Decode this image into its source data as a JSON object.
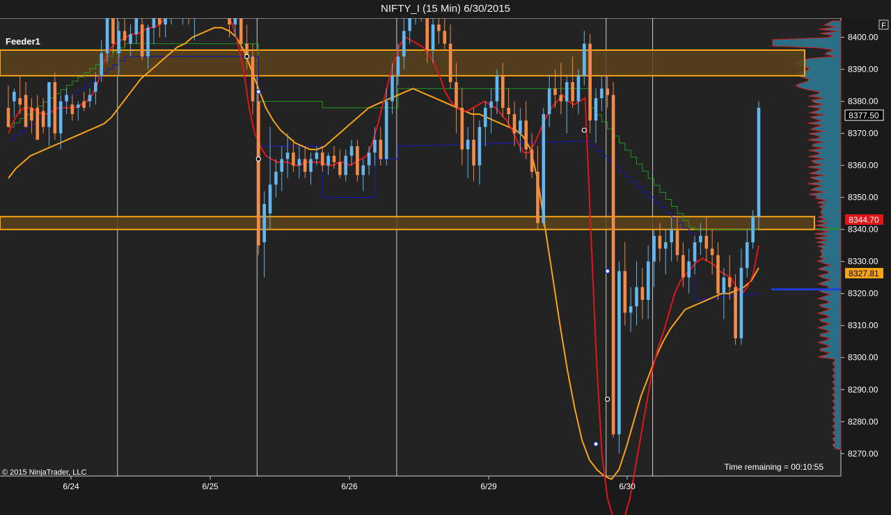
{
  "window": {
    "title": "NIFTY_I (15 Min)  6/30/2015",
    "f_button": "F"
  },
  "panel": {
    "feeder_label": "Feeder1",
    "copyright": "© 2015 NinjaTrader, LLC",
    "time_remaining": "Time remaining = 00:10:55"
  },
  "price_markers": {
    "last": "8377.50",
    "red": "8344.70",
    "orange": "8327.81"
  },
  "colors": {
    "background": "#232323",
    "up_candle": "#63b6ee",
    "down_candle": "#f18b4a",
    "red_ma": "#e0161b",
    "orange_ma": "#f7a416",
    "blue_line": "#1a1aa0",
    "green_line": "#1f9a1f",
    "zone_fill": "#5a431c",
    "zone_border": "#f7a416",
    "profile_fill": "#2a6f85",
    "profile_edge": "#d81e1e"
  },
  "chart_data": {
    "type": "candlestick",
    "title": "NIFTY_I (15 Min)  6/30/2015",
    "ylim": [
      8263,
      8406
    ],
    "y_ticks": [
      "8400.00",
      "8390.00",
      "8380.00",
      "8370.00",
      "8360.00",
      "8350.00",
      "8340.00",
      "8330.00",
      "8320.00",
      "8310.00",
      "8300.00",
      "8290.00",
      "8280.00",
      "8270.00"
    ],
    "x_ticks": [
      "6/24",
      "6/25",
      "6/26",
      "6/29",
      "6/30"
    ],
    "zones": [
      {
        "top": 8396,
        "bottom": 8388
      },
      {
        "top": 8344,
        "bottom": 8340
      }
    ],
    "candles": [
      [
        8378,
        8385,
        8372,
        8372
      ],
      [
        8380,
        8384,
        8375,
        8383
      ],
      [
        8381,
        8388,
        8376,
        8379
      ],
      [
        8382,
        8386,
        8372,
        8372
      ],
      [
        8378,
        8381,
        8370,
        8374
      ],
      [
        8378,
        8382,
        8368,
        8368
      ],
      [
        8377,
        8381,
        8370,
        8372
      ],
      [
        8372,
        8386,
        8366,
        8386
      ],
      [
        8386,
        8389,
        8368,
        8370
      ],
      [
        8370,
        8382,
        8365,
        8380
      ],
      [
        8380,
        8384,
        8376,
        8382
      ],
      [
        8379,
        8382,
        8374,
        8376
      ],
      [
        8378,
        8380,
        8374,
        8379
      ],
      [
        8380,
        8383,
        8377,
        8378
      ],
      [
        8380,
        8384,
        8378,
        8382
      ],
      [
        8383,
        8389,
        8379,
        8386
      ],
      [
        8388,
        8399,
        8386,
        8395
      ],
      [
        8395,
        8412,
        8392,
        8412
      ],
      [
        8410,
        8414,
        8395,
        8398
      ],
      [
        8395,
        8405,
        8388,
        8402
      ],
      [
        8402,
        8406,
        8397,
        8399
      ],
      [
        8398,
        8404,
        8394,
        8401
      ],
      [
        8401,
        8411,
        8398,
        8409
      ],
      [
        8404,
        8407,
        8393,
        8394
      ],
      [
        8394,
        8404,
        8390,
        8403
      ],
      [
        8403,
        8410,
        8398,
        8406
      ],
      [
        8406,
        8411,
        8400,
        8404
      ],
      [
        8404,
        8412,
        8400,
        8410
      ],
      [
        8410,
        8416,
        8404,
        8414
      ],
      [
        8414,
        8418,
        8408,
        8410
      ],
      [
        8410,
        8416,
        8404,
        8412
      ],
      [
        8412,
        8416,
        8404,
        8406
      ],
      [
        8406,
        8414,
        8399,
        8410
      ],
      [
        8410,
        8418,
        8406,
        8414
      ],
      [
        8414,
        8420,
        8410,
        8416
      ],
      [
        8416,
        8420,
        8412,
        8418
      ],
      [
        8418,
        8422,
        8412,
        8414
      ],
      [
        8414,
        8418,
        8408,
        8410
      ],
      [
        8410,
        8414,
        8400,
        8404
      ],
      [
        8404,
        8412,
        8400,
        8408
      ],
      [
        8408,
        8412,
        8396,
        8398
      ],
      [
        8398,
        8404,
        8390,
        8394
      ],
      [
        8394,
        8398,
        8376,
        8380
      ],
      [
        8380,
        8384,
        8332,
        8335
      ],
      [
        8336,
        8352,
        8325,
        8348
      ],
      [
        8345,
        8372,
        8340,
        8354
      ],
      [
        8354,
        8362,
        8350,
        8358
      ],
      [
        8358,
        8366,
        8352,
        8362
      ],
      [
        8362,
        8370,
        8356,
        8364
      ],
      [
        8364,
        8368,
        8358,
        8360
      ],
      [
        8360,
        8366,
        8356,
        8362
      ],
      [
        8362,
        8366,
        8356,
        8358
      ],
      [
        8358,
        8364,
        8354,
        8362
      ],
      [
        8362,
        8366,
        8360,
        8364
      ],
      [
        8364,
        8366,
        8358,
        8360
      ],
      [
        8360,
        8364,
        8357,
        8363
      ],
      [
        8363,
        8366,
        8359,
        8361
      ],
      [
        8361,
        8365,
        8356,
        8357
      ],
      [
        8357,
        8365,
        8355,
        8363
      ],
      [
        8363,
        8368,
        8360,
        8366
      ],
      [
        8366,
        8368,
        8355,
        8357
      ],
      [
        8357,
        8362,
        8352,
        8360
      ],
      [
        8360,
        8366,
        8357,
        8364
      ],
      [
        8364,
        8372,
        8360,
        8368
      ],
      [
        8368,
        8372,
        8360,
        8362
      ],
      [
        8362,
        8384,
        8360,
        8380
      ],
      [
        8380,
        8392,
        8376,
        8388
      ],
      [
        8388,
        8398,
        8385,
        8394
      ],
      [
        8394,
        8406,
        8390,
        8402
      ],
      [
        8402,
        8412,
        8398,
        8408
      ],
      [
        8408,
        8418,
        8404,
        8414
      ],
      [
        8414,
        8420,
        8405,
        8408
      ],
      [
        8408,
        8412,
        8392,
        8396
      ],
      [
        8396,
        8408,
        8392,
        8404
      ],
      [
        8404,
        8412,
        8398,
        8402
      ],
      [
        8402,
        8408,
        8396,
        8398
      ],
      [
        8398,
        8404,
        8384,
        8386
      ],
      [
        8386,
        8392,
        8370,
        8378
      ],
      [
        8378,
        8384,
        8360,
        8365
      ],
      [
        8365,
        8372,
        8356,
        8368
      ],
      [
        8368,
        8378,
        8355,
        8360
      ],
      [
        8360,
        8374,
        8354,
        8372
      ],
      [
        8372,
        8380,
        8366,
        8378
      ],
      [
        8378,
        8384,
        8370,
        8380
      ],
      [
        8380,
        8390,
        8376,
        8388
      ],
      [
        8388,
        8392,
        8375,
        8378
      ],
      [
        8378,
        8384,
        8372,
        8376
      ],
      [
        8376,
        8380,
        8366,
        8370
      ],
      [
        8370,
        8378,
        8364,
        8374
      ],
      [
        8374,
        8380,
        8362,
        8365
      ],
      [
        8365,
        8370,
        8356,
        8358
      ],
      [
        8358,
        8366,
        8340,
        8342
      ],
      [
        8342,
        8378,
        8341,
        8376
      ],
      [
        8376,
        8388,
        8372,
        8384
      ],
      [
        8384,
        8390,
        8378,
        8382
      ],
      [
        8382,
        8392,
        8376,
        8380
      ],
      [
        8380,
        8388,
        8370,
        8386
      ],
      [
        8386,
        8394,
        8378,
        8380
      ],
      [
        8380,
        8390,
        8376,
        8388
      ],
      [
        8388,
        8402,
        8385,
        8398
      ],
      [
        8398,
        8401,
        8370,
        8374
      ],
      [
        8374,
        8384,
        8367,
        8381
      ],
      [
        8381,
        8388,
        8377,
        8384
      ],
      [
        8384,
        8388,
        8378,
        8382
      ],
      [
        8382,
        8386,
        8275,
        8276
      ],
      [
        8276,
        8330,
        8270,
        8327
      ],
      [
        8327,
        8336,
        8310,
        8314
      ],
      [
        8314,
        8322,
        8308,
        8316
      ],
      [
        8316,
        8330,
        8310,
        8322
      ],
      [
        8322,
        8328,
        8312,
        8318
      ],
      [
        8318,
        8335,
        8312,
        8330
      ],
      [
        8330,
        8340,
        8322,
        8338
      ],
      [
        8338,
        8342,
        8330,
        8334
      ],
      [
        8334,
        8340,
        8326,
        8336
      ],
      [
        8336,
        8344,
        8330,
        8340
      ],
      [
        8340,
        8344,
        8330,
        8332
      ],
      [
        8332,
        8336,
        8322,
        8325
      ],
      [
        8325,
        8334,
        8320,
        8330
      ],
      [
        8330,
        8338,
        8326,
        8336
      ],
      [
        8336,
        8342,
        8332,
        8338
      ],
      [
        8338,
        8344,
        8330,
        8334
      ],
      [
        8334,
        8340,
        8326,
        8332
      ],
      [
        8332,
        8336,
        8318,
        8320
      ],
      [
        8320,
        8328,
        8312,
        8325
      ],
      [
        8325,
        8332,
        8318,
        8322
      ],
      [
        8322,
        8326,
        8304,
        8306
      ],
      [
        8306,
        8334,
        8304,
        8328
      ],
      [
        8328,
        8340,
        8325,
        8336
      ],
      [
        8336,
        8346,
        8334,
        8344
      ],
      [
        8344,
        8380,
        8340,
        8378
      ]
    ],
    "red_ma": [
      8370,
      8374,
      8377,
      8378,
      8378,
      8377,
      8376,
      8376,
      8377,
      8378,
      8378,
      8378,
      8378,
      8379,
      8380,
      8382,
      8386,
      8392,
      8396,
      8398,
      8399,
      8400,
      8401,
      8401,
      8402,
      8403,
      8403,
      8404,
      8406,
      8407,
      8408,
      8408,
      8409,
      8410,
      8411,
      8412,
      8413,
      8412,
      8410,
      8408,
      8404,
      8398,
      8390,
      8378,
      8370,
      8366,
      8363,
      8362,
      8361,
      8361,
      8361,
      8360,
      8360,
      8361,
      8361,
      8361,
      8361,
      8360,
      8360,
      8361,
      8361,
      8360,
      8361,
      8362,
      8363,
      8367,
      8373,
      8380,
      8387,
      8393,
      8398,
      8400,
      8399,
      8398,
      8397,
      8395,
      8392,
      8388,
      8383,
      8380,
      8378,
      8377,
      8377,
      8378,
      8379,
      8380,
      8379,
      8378,
      8376,
      8374,
      8371,
      8367,
      8364,
      8364,
      8367,
      8371,
      8375,
      8378,
      8380,
      8382,
      8380,
      8379,
      8380,
      8381,
      8340,
      8300,
      8270,
      8256,
      8250,
      8248,
      8250,
      8256,
      8266,
      8276,
      8286,
      8296,
      8303,
      8308,
      8314,
      8320,
      8324,
      8326,
      8328,
      8330,
      8331,
      8330,
      8329,
      8327,
      8326,
      8325,
      8322,
      8320,
      8322,
      8326,
      8335
    ],
    "orange_ma": [
      8356,
      8359,
      8361,
      8363,
      8364,
      8365,
      8366,
      8367,
      8368,
      8369,
      8370,
      8371,
      8372,
      8373,
      8375,
      8378,
      8381,
      8384,
      8387,
      8389,
      8391,
      8393,
      8395,
      8397,
      8398,
      8400,
      8401,
      8402,
      8403,
      8403,
      8402,
      8400,
      8396,
      8390,
      8384,
      8378,
      8374,
      8371,
      8369,
      8367,
      8366,
      8365,
      8365,
      8366,
      8368,
      8370,
      8372,
      8374,
      8376,
      8378,
      8379,
      8380,
      8381,
      8382,
      8383,
      8384,
      8383,
      8382,
      8381,
      8380,
      8379,
      8378,
      8377,
      8376,
      8376,
      8375,
      8374,
      8373,
      8372,
      8371,
      8369,
      8365,
      8355,
      8340,
      8325,
      8310,
      8296,
      8284,
      8274,
      8268,
      8265,
      8263,
      8262,
      8265,
      8272,
      8280,
      8288,
      8294,
      8300,
      8305,
      8309,
      8312,
      8315,
      8316,
      8317,
      8318,
      8319,
      8320,
      8320,
      8321,
      8322,
      8324,
      8328
    ]
  }
}
